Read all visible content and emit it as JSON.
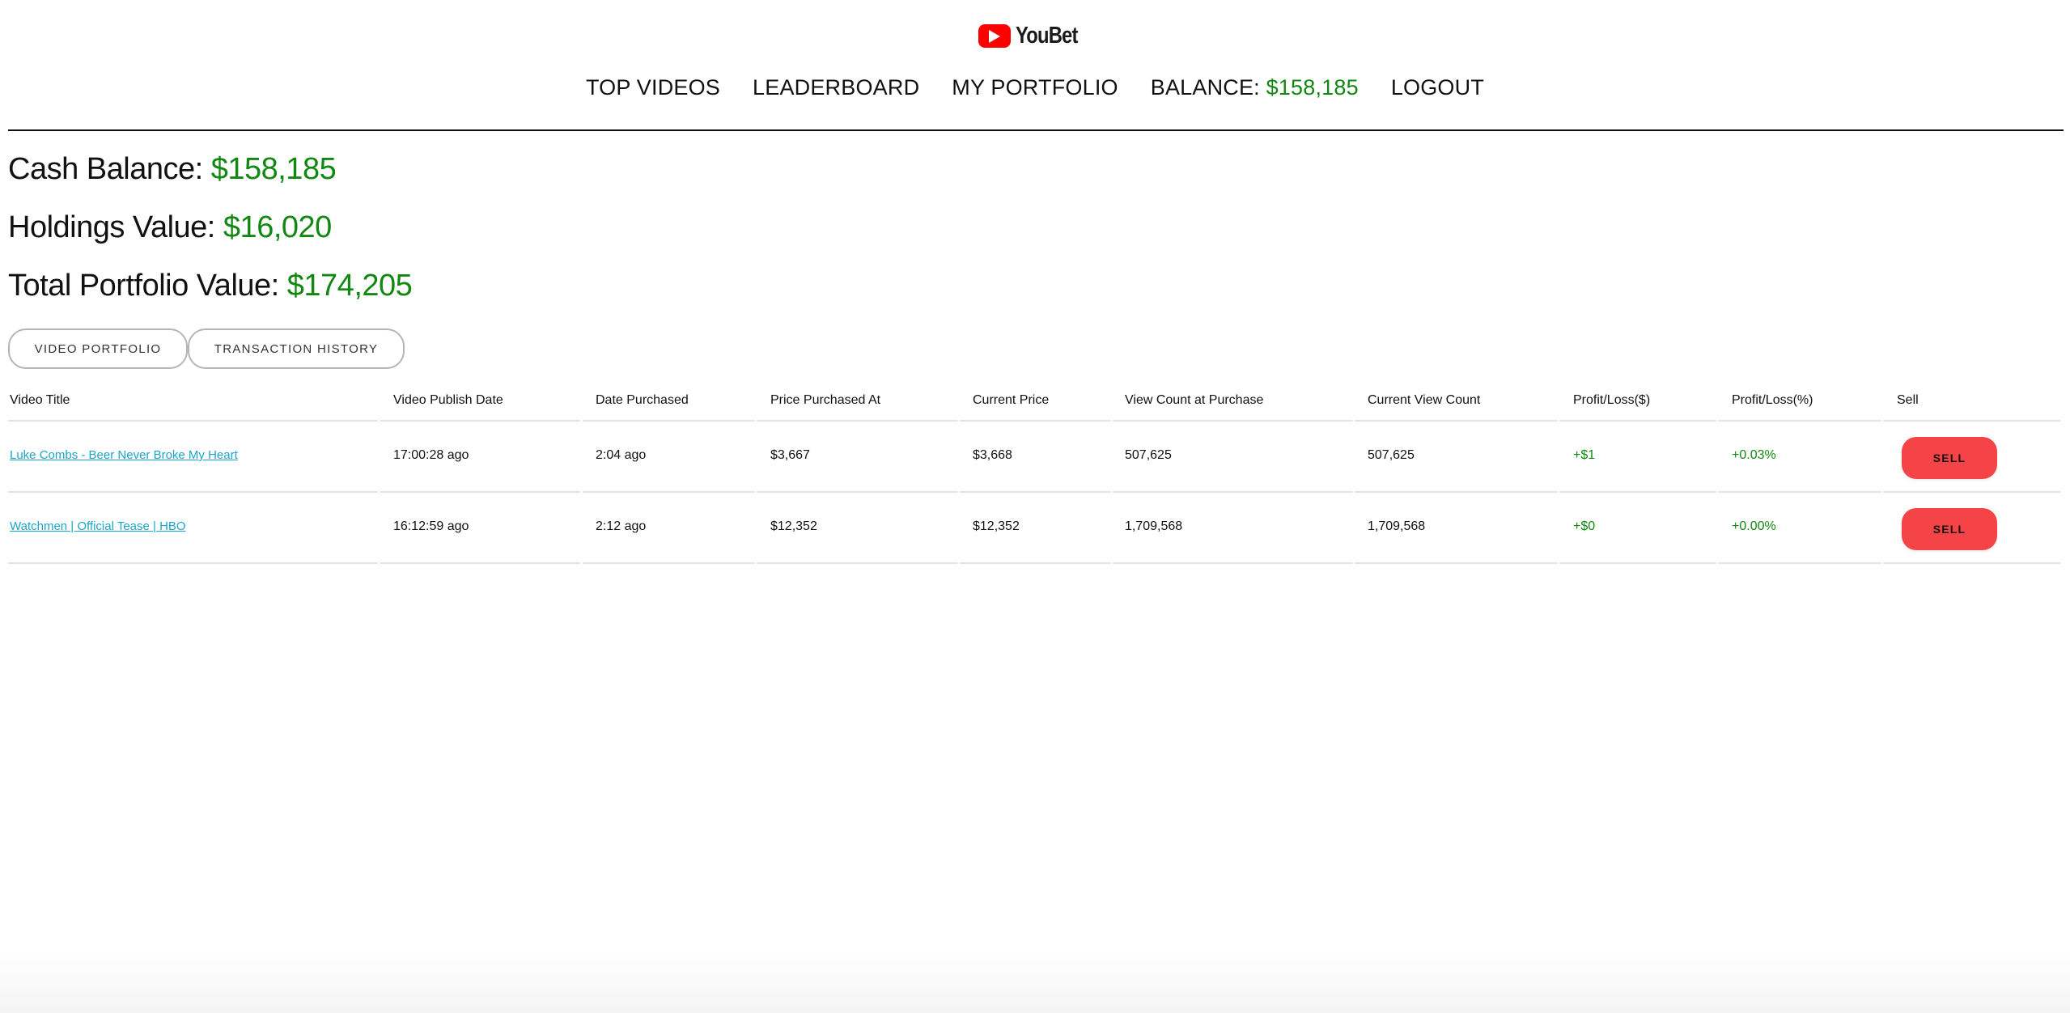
{
  "app": {
    "logo_text": "YouBet"
  },
  "nav": {
    "top_videos": "TOP VIDEOS",
    "leaderboard": "LEADERBOARD",
    "my_portfolio": "MY PORTFOLIO",
    "balance_label": "BALANCE:",
    "balance_value": "$158,185",
    "logout": "LOGOUT"
  },
  "summary": {
    "cash_label": "Cash Balance:",
    "cash_value": "$158,185",
    "holdings_label": "Holdings Value:",
    "holdings_value": "$16,020",
    "total_label": "Total Portfolio Value:",
    "total_value": "$174,205"
  },
  "tabs": {
    "video_portfolio": "VIDEO PORTFOLIO",
    "transaction_history": "TRANSACTION HISTORY"
  },
  "table": {
    "headers": [
      "Video Title",
      "Video Publish Date",
      "Date Purchased",
      "Price Purchased At",
      "Current Price",
      "View Count at Purchase",
      "Current View Count",
      "Profit/Loss($)",
      "Profit/Loss(%)",
      "Sell"
    ],
    "rows": [
      {
        "title": "Luke Combs - Beer Never Broke My Heart",
        "publish": "17:00:28 ago",
        "purchased": "2:04 ago",
        "price_at": "$3,667",
        "current_price": "$3,668",
        "views_at": "507,625",
        "current_views": "507,625",
        "pl_dollar": "+$1",
        "pl_pct": "+0.03%",
        "sell": "SELL"
      },
      {
        "title": "Watchmen | Official Tease | HBO",
        "publish": "16:12:59 ago",
        "purchased": "2:12 ago",
        "price_at": "$12,352",
        "current_price": "$12,352",
        "views_at": "1,709,568",
        "current_views": "1,709,568",
        "pl_dollar": "+$0",
        "pl_pct": "+0.00%",
        "sell": "SELL"
      }
    ]
  },
  "colors": {
    "positive": "#118811",
    "link": "#1aa6c8",
    "sell_button": "#f44448",
    "brand_red": "#ff0000"
  },
  "icons": {
    "logo": "play-icon"
  }
}
